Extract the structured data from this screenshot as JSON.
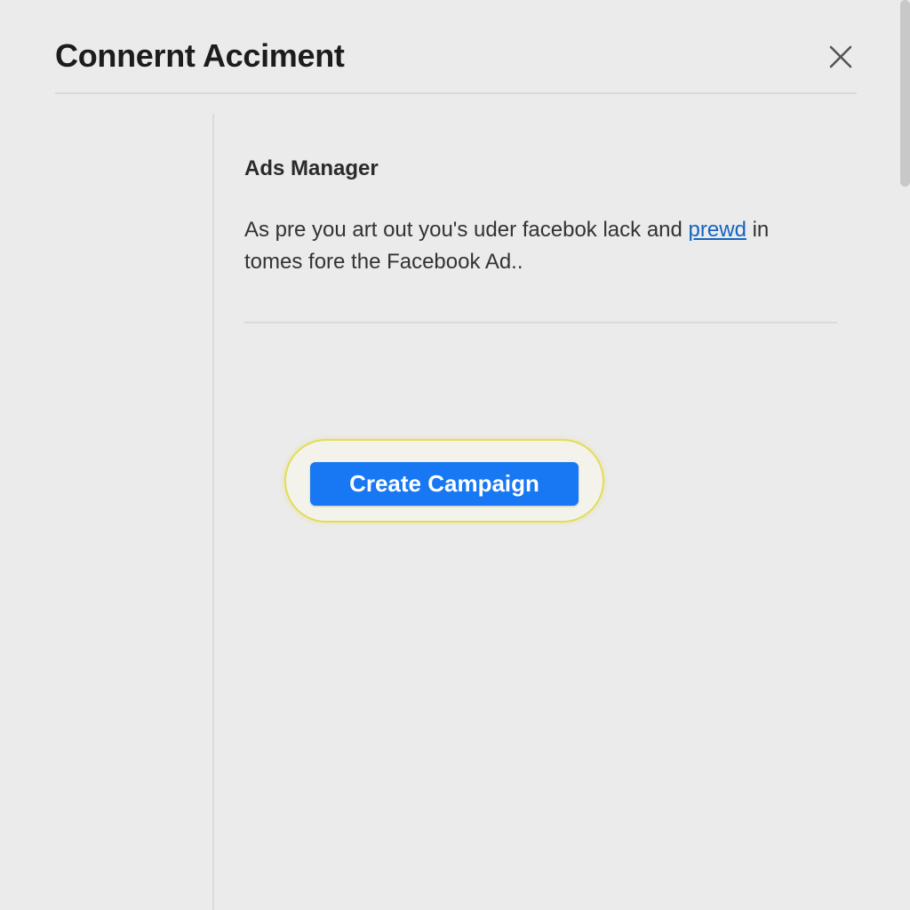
{
  "dialog": {
    "title": "Connernt Acciment",
    "close_icon": "close-icon"
  },
  "content": {
    "section_title": "Ads Manager",
    "description_before_link": "As pre you art out you's uder facebok lack and ",
    "description_link": "prewd",
    "description_after_link": " in tomes fore the Facebook Ad.."
  },
  "actions": {
    "create_campaign_label": "Create Campaign"
  },
  "colors": {
    "accent": "#1877f2",
    "link": "#1565c0",
    "highlight": "#e3dc5a",
    "background": "#ebebeb"
  }
}
